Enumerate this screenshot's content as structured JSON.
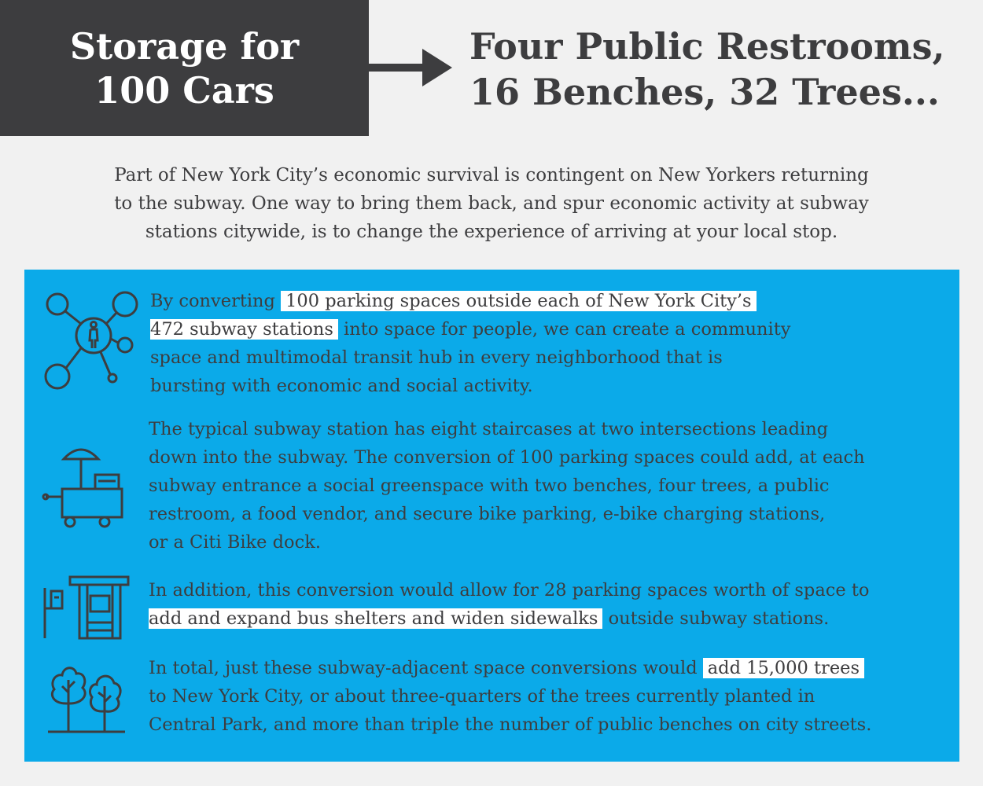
{
  "header": {
    "left_line1": "Storage for",
    "left_line2": "100 Cars",
    "right_line1": "Four Public Restrooms,",
    "right_line2": "16 Benches, 32 Trees..."
  },
  "intro": {
    "line1": "Part of New York City’s economic survival is contingent on New Yorkers returning",
    "line2": "to the subway. One way to bring them back, and spur economic activity at subway",
    "line3": "stations citywide, is to change the experience of arriving at your local stop."
  },
  "sections": [
    {
      "icon": "pedestrian-network-icon",
      "l1a": "By converting ",
      "l1b": "100 parking spaces outside each of New York City’s",
      "l2a": "472 subway stations",
      "l2b": " into space for people, we can create a community",
      "l3": "space and multimodal transit hub in every neighborhood that is",
      "l4": "bursting with economic and social activity."
    },
    {
      "icon": "food-cart-icon",
      "l1": "The typical subway station has eight staircases at two intersections leading",
      "l2": "down into the subway. The conversion of 100 parking spaces could add, at each",
      "l3": "subway entrance a social greenspace with two benches, four trees, a public",
      "l4": "restroom, a food vendor, and secure bike parking, e-bike charging stations,",
      "l5": "or a Citi Bike dock."
    },
    {
      "icon": "bus-shelter-icon",
      "l1": "In addition, this conversion would allow for 28 parking spaces worth of space to",
      "l2a": "add and expand bus shelters and widen sidewalks",
      "l2b": " outside subway stations."
    },
    {
      "icon": "trees-icon",
      "l1a": "In total, just these subway-adjacent space conversions would ",
      "l1b": "add 15,000 trees",
      "l2": "to New York City, or about three-quarters of the trees currently planted in",
      "l3": "Central Park, and more than triple the number of public benches on city streets."
    }
  ],
  "colors": {
    "dark": "#3d3d3f",
    "panel_blue": "#0baae9",
    "background": "#f1f1f1",
    "highlight": "#ffffff"
  }
}
